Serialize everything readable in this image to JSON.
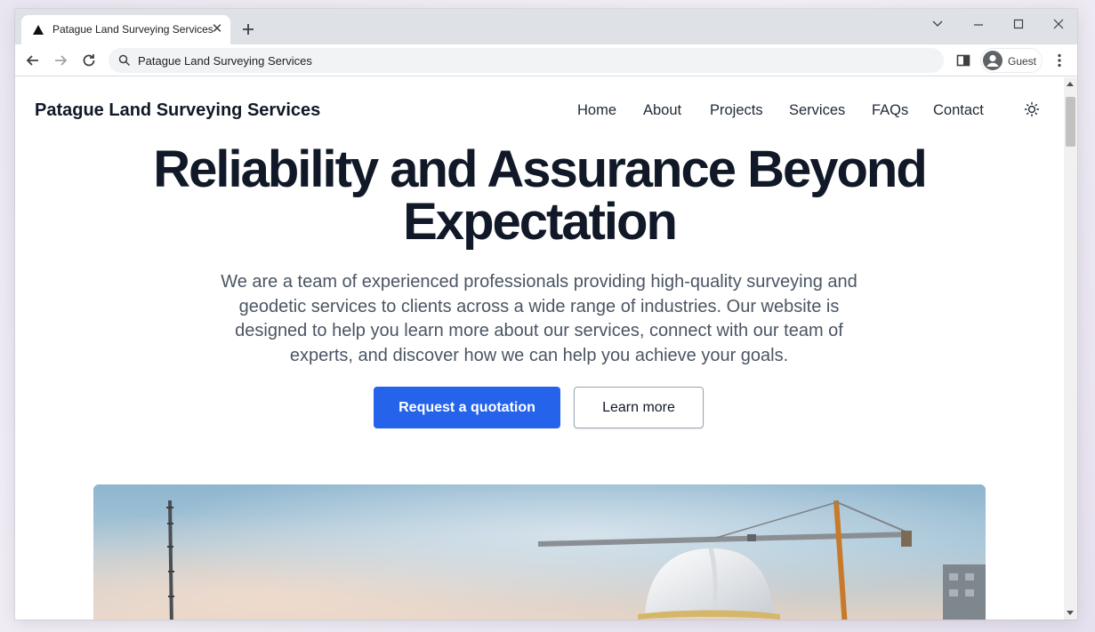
{
  "browser": {
    "tab_title": "Patague Land Surveying Services",
    "address": "Patague Land Surveying Services",
    "profile_label": "Guest"
  },
  "site": {
    "brand": "Patague Land Surveying Services",
    "nav": [
      "Home",
      "About",
      "Projects",
      "Services",
      "FAQs",
      "Contact"
    ]
  },
  "hero": {
    "title_line1": "Reliability and Assurance Beyond",
    "title_line2": "Expectation",
    "text_line1": "We are a team of experienced professionals providing high-quality surveying and",
    "text_line2": "geodetic services to clients across a wide range of industries. Our website is",
    "text_line3": "designed to help you learn more about our services, connect with our team of",
    "text_line4": "experts, and discover how we can help you achieve your goals.",
    "primary_button": "Request a quotation",
    "secondary_button": "Learn more"
  },
  "colors": {
    "accent": "#2563eb",
    "heading": "#111827",
    "body_text": "#4b5563"
  },
  "icons": [
    "tab-favicon-triangle",
    "close-icon",
    "plus-icon",
    "chevron-down-icon",
    "minimize-icon",
    "maximize-icon",
    "window-close-icon",
    "back-arrow-icon",
    "forward-arrow-icon",
    "reload-icon",
    "search-icon",
    "side-panel-icon",
    "avatar-icon",
    "more-vert-icon",
    "sun-icon"
  ]
}
